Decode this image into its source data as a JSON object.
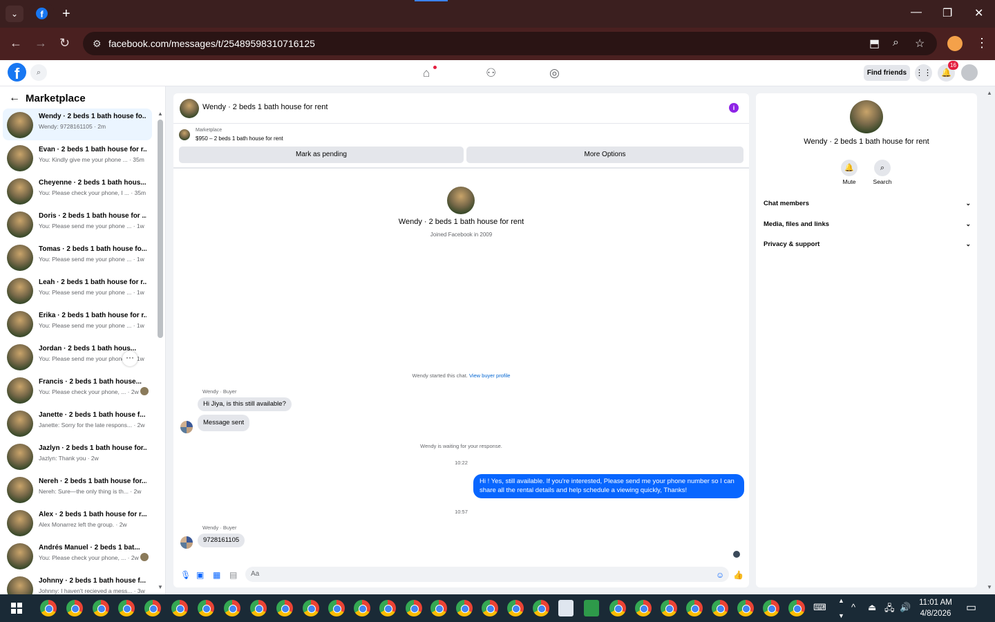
{
  "browser": {
    "url": "facebook.com/messages/t/25489598310716125"
  },
  "fb_header": {
    "find_friends": "Find friends",
    "notif_count": "16"
  },
  "sidebar": {
    "title": "Marketplace",
    "conversations": [
      {
        "name": "Wendy · 2 beds 1 bath house fo...",
        "preview": "Wendy: 9728161105 · 2m"
      },
      {
        "name": "Evan · 2 beds 1 bath house for r...",
        "preview": "You: Kindly give me your phone ... · 35m"
      },
      {
        "name": "Cheyenne · 2 beds 1 bath hous...",
        "preview": "You: Please check your phone, I ... · 35m"
      },
      {
        "name": "Doris · 2 beds 1 bath house for ...",
        "preview": "You: Please send me your phone ... · 1w"
      },
      {
        "name": "Tomas · 2 beds 1 bath house fo...",
        "preview": "You: Please send me your phone ... · 1w"
      },
      {
        "name": "Leah · 2 beds 1 bath house for r...",
        "preview": "You: Please send me your phone ... · 1w"
      },
      {
        "name": "Erika · 2 beds 1 bath house for r...",
        "preview": "You: Please send me your phone ... · 1w"
      },
      {
        "name": "Jordan · 2 beds 1 bath hous...",
        "preview": "You: Please send me your phone ... · 1w"
      },
      {
        "name": "Francis · 2 beds 1 bath house...",
        "preview": "You: Please check your phone, ... · 2w"
      },
      {
        "name": "Janette · 2 beds 1 bath house f...",
        "preview": "Janette: Sorry for the late respons... · 2w"
      },
      {
        "name": "Jazlyn · 2 beds 1 bath house for...",
        "preview": "Jazlyn: Thank you · 2w"
      },
      {
        "name": "Nereh · 2 beds 1 bath house for...",
        "preview": "Nereh: Sure—the only thing is th... · 2w"
      },
      {
        "name": "Alex · 2 beds 1 bath house for r...",
        "preview": "Alex Monarrez left the group. · 2w"
      },
      {
        "name": "Andrés Manuel · 2 beds 1 bat...",
        "preview": "You: Please check your phone, ... · 2w"
      },
      {
        "name": "Johnny · 2 beds 1 bath house f...",
        "preview": "Johnny: I haven't recieved a mess... · 3w"
      }
    ]
  },
  "chat": {
    "title": "Wendy · 2 beds 1 bath house for rent",
    "marketplace_label": "Marketplace",
    "listing": "$950 – 2 beds 1 bath house for rent",
    "mark_pending": "Mark as pending",
    "more_options": "More Options",
    "profile_name": "Wendy · 2 beds 1 bath house for rent",
    "joined": "Joined Facebook in 2009",
    "started": "Wendy started this chat.",
    "view_profile": "View buyer profile",
    "sender_label": "Wendy · Buyer",
    "msg1": "Hi Jiya, is this still available?",
    "msg2": "Message sent",
    "waiting": "Wendy is waiting for your response.",
    "time1": "10:22",
    "outgoing": "Hi ! Yes, still available. If you're interested, Please send me your phone number so I can share all the rental details and help schedule a viewing quickly, Thanks!",
    "time2": "10:57",
    "msg3": "9728161105",
    "input_placeholder": "Aa"
  },
  "info_panel": {
    "name": "Wendy · 2 beds 1 bath house for rent",
    "mute": "Mute",
    "search": "Search",
    "sections": [
      "Chat members",
      "Media, files and links",
      "Privacy & support"
    ]
  },
  "taskbar": {
    "time": "11:01 AM",
    "date": "4/8/2026"
  }
}
